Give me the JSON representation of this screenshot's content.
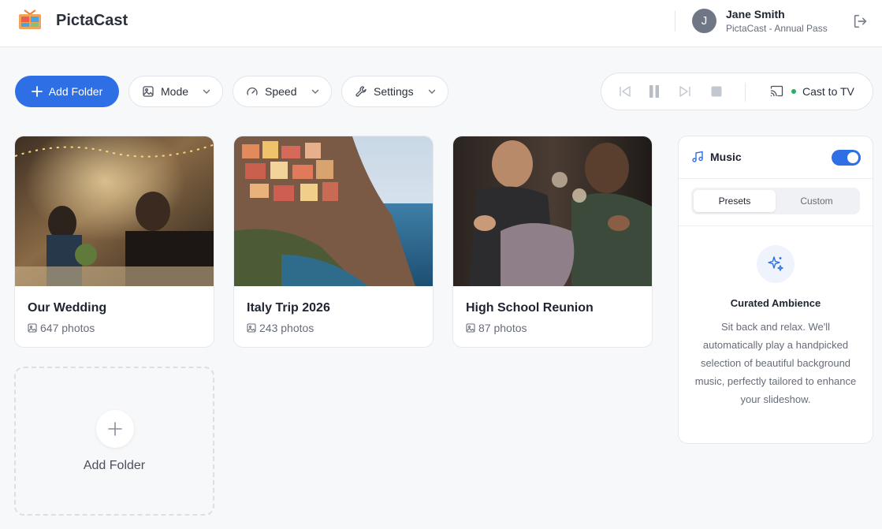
{
  "app": {
    "name": "PictaCast"
  },
  "user": {
    "initial": "J",
    "name": "Jane Smith",
    "plan": "PictaCast - Annual Pass"
  },
  "toolbar": {
    "add_folder": "Add Folder",
    "mode": "Mode",
    "speed": "Speed",
    "settings": "Settings"
  },
  "player": {
    "cast_label": "Cast to TV",
    "cast_status_color": "#22b35e"
  },
  "folders": [
    {
      "title": "Our Wedding",
      "count": "647 photos"
    },
    {
      "title": "Italy Trip 2026",
      "count": "243 photos"
    },
    {
      "title": "High School Reunion",
      "count": "87 photos"
    }
  ],
  "add_folder_card": {
    "label": "Add Folder"
  },
  "music": {
    "title": "Music",
    "enabled": true,
    "tabs": [
      {
        "label": "Presets",
        "active": true
      },
      {
        "label": "Custom",
        "active": false
      }
    ],
    "preset_title": "Curated Ambience",
    "preset_description": "Sit back and relax. We'll automatically play a handpicked selection of beautiful background music, perfectly tailored to enhance your slideshow."
  },
  "colors": {
    "accent": "#2f6fe6",
    "background": "#f7f8fa"
  }
}
